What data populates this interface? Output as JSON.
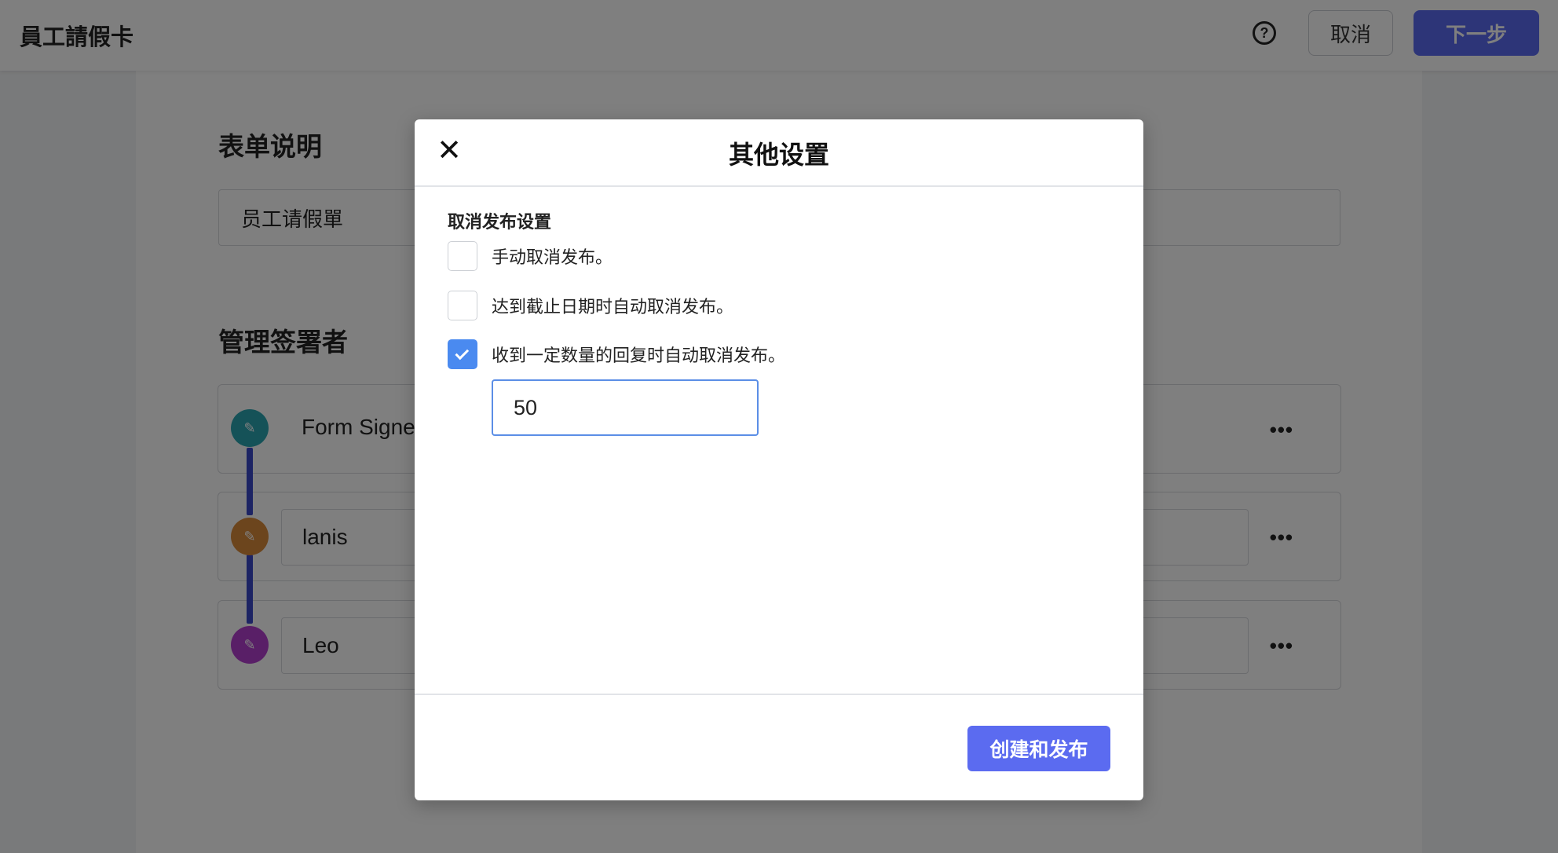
{
  "header": {
    "title": "員工請假卡",
    "help_icon": "?",
    "cancel_label": "取消",
    "next_label": "下一步"
  },
  "main": {
    "description_section_title": "表单说明",
    "description_value": "员工请假單",
    "signers_section_title": "管理签署者",
    "signers": [
      {
        "name": "Form Signer",
        "avatar_color": "#2aa5b0",
        "avatar_icon": "pen-icon"
      },
      {
        "name": "lanis",
        "avatar_color": "#d98a3a",
        "avatar_icon": "pen-icon"
      },
      {
        "name": "Leo",
        "avatar_color": "#b33fcf",
        "avatar_icon": "pen-icon"
      }
    ],
    "more_icon": "•••"
  },
  "modal": {
    "title": "其他设置",
    "close_icon": "✕",
    "section_label": "取消发布设置",
    "options": [
      {
        "label": "手动取消发布。",
        "checked": false
      },
      {
        "label": "达到截止日期时自动取消发布。",
        "checked": false
      },
      {
        "label": "收到一定数量的回复时自动取消发布。",
        "checked": true
      }
    ],
    "response_count": "50",
    "publish_label": "创建和发布"
  },
  "colors": {
    "accent": "#5b6bf0",
    "checkbox_checked": "#4a8af0",
    "connector": "#3b48c9"
  }
}
